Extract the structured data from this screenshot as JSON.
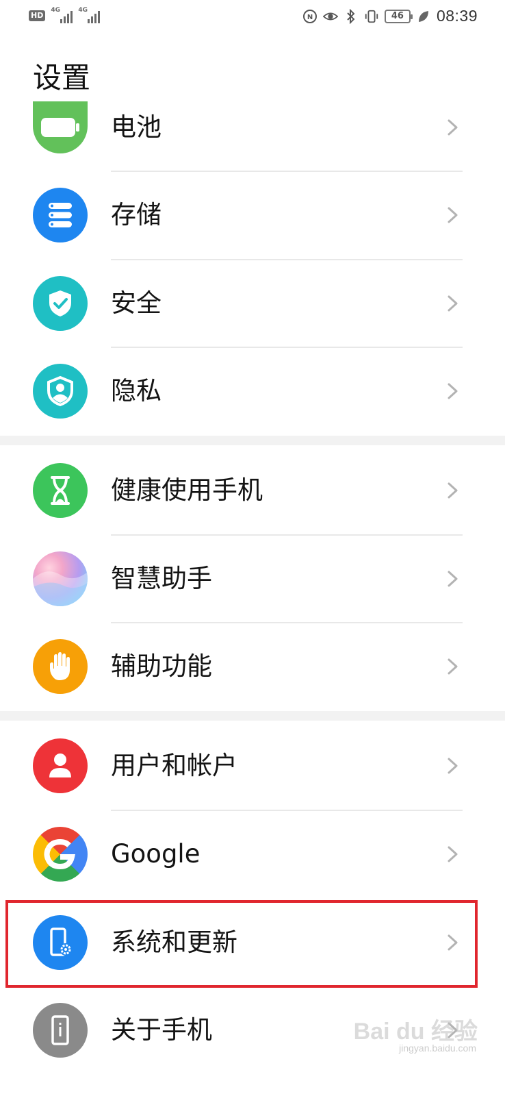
{
  "status_bar": {
    "hd_label": "HD",
    "sim1_label": "4G",
    "sim2_label": "4G",
    "battery_level": "46",
    "time": "08:39",
    "icons": [
      "nfc-icon",
      "eye-comfort-icon",
      "bluetooth-icon",
      "vibrate-icon",
      "battery-icon",
      "leaf-icon"
    ]
  },
  "page": {
    "title": "设置"
  },
  "settings_items": [
    {
      "id": "battery",
      "label": "电池",
      "icon": "battery-icon",
      "color": "#62c15a"
    },
    {
      "id": "storage",
      "label": "存储",
      "icon": "storage-icon",
      "color": "#1e86f0"
    },
    {
      "id": "security",
      "label": "安全",
      "icon": "shield-check-icon",
      "color": "#1fbfc4"
    },
    {
      "id": "privacy",
      "label": "隐私",
      "icon": "privacy-icon",
      "color": "#1fbfc4"
    },
    {
      "id": "digital-balance",
      "label": "健康使用手机",
      "icon": "hourglass-icon",
      "color": "#3cc55b"
    },
    {
      "id": "assistant",
      "label": "智慧助手",
      "icon": "assistant-icon",
      "color": "#c49be8"
    },
    {
      "id": "accessibility",
      "label": "辅助功能",
      "icon": "hand-icon",
      "color": "#f7a007"
    },
    {
      "id": "users-accounts",
      "label": "用户和帐户",
      "icon": "user-icon",
      "color": "#ee3338"
    },
    {
      "id": "google",
      "label": "Google",
      "icon": "google-icon",
      "color": "#4285f4"
    },
    {
      "id": "system-update",
      "label": "系统和更新",
      "icon": "phone-gear-icon",
      "color": "#1e86f0",
      "highlighted": true
    },
    {
      "id": "about-phone",
      "label": "关于手机",
      "icon": "phone-info-icon",
      "color": "#8a8a8a"
    }
  ],
  "watermark": {
    "text": "Bai du 经验",
    "sub": "jingyan.baidu.com"
  }
}
